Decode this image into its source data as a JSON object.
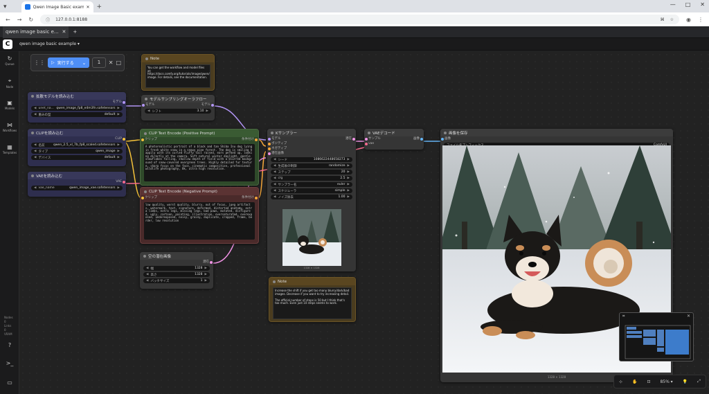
{
  "browser": {
    "tab_title": "Qwen Image Basic example",
    "new_tab": "+",
    "url": "127.0.0.1:8188",
    "window_controls": [
      "—",
      "□",
      "✕"
    ]
  },
  "workflow": {
    "tab_label": "qwen image basic e...",
    "tab_close": "✕",
    "add_tab": "+",
    "menu_title": "qwen image basic example ▾"
  },
  "sidebar": [
    {
      "label": "Queue",
      "icon": "history-icon",
      "glyph": "↻"
    },
    {
      "label": "Node",
      "icon": "node-library-icon",
      "glyph": "⌖"
    },
    {
      "label": "Models",
      "icon": "models-icon",
      "glyph": "▣"
    },
    {
      "label": "Workflows",
      "icon": "workflows-icon",
      "glyph": "⋈"
    },
    {
      "label": "Templates",
      "icon": "templates-icon",
      "glyph": "▦"
    }
  ],
  "sidebar_bottom": [
    {
      "icon": "help-icon",
      "glyph": "?"
    },
    {
      "icon": "terminal-icon",
      "glyph": ">_"
    },
    {
      "icon": "console-icon",
      "glyph": "▭"
    }
  ],
  "run": {
    "label": "実行する",
    "count": "1",
    "cancel": "✕",
    "stop": "□"
  },
  "nodes": {
    "note1": {
      "title": "Note",
      "text": "You can get the workflow and model files at: https://docs.comfy.org/tutorials/image/qwen/qwen-image. For details, see the documentation."
    },
    "sampling": {
      "title": "モデルサンプリングオーラフロー",
      "in_model": "モデル",
      "out_model": "モデル",
      "w_shift": {
        "name": "シフト",
        "value": "3.10"
      }
    },
    "unet": {
      "title": "拡散モデルを読み込む",
      "out": "モデル",
      "w_name": {
        "name": "unet_na...",
        "value": "qwen_image_fp8_e4m3fn.safetensors"
      },
      "w_dtype": {
        "name": "重みの型",
        "value": "default"
      }
    },
    "clip": {
      "title": "CLIPを読み込む",
      "out": "CLIP",
      "w_name": {
        "name": "名前",
        "value": "qwen_2.5_vl_7b_fp8_scaled.safetensors"
      },
      "w_type": {
        "name": "タイプ",
        "value": "qwen_image"
      },
      "w_device": {
        "name": "デバイス",
        "value": "default"
      }
    },
    "vae": {
      "title": "VAEを読み込む",
      "out": "VAE",
      "w_name": {
        "name": "vae_name",
        "value": "qwen_image_vae.safetensors"
      }
    },
    "pos": {
      "title": "CLIP Text Encode (Positive Prompt)",
      "in_clip": "クリップ",
      "out_cond": "条件付け",
      "text": "A photorealistic portrait of a black and tan Shiba Inu dog lying in fresh white snow in a snowy pine forest. The dog is smiling happily with its curled fluffy tail raised, ears perked up, looking directly at the camera. Soft natural winter daylight, gentle snowflakes falling, shallow depth of field with a blurred background of snow-covered evergreen trees. Highly detailed fur texture, sharp focus on the face, cinematic composition, professional wildlife photography, 8k, ultra high resolution."
    },
    "neg": {
      "title": "CLIP Text Encode (Negative Prompt)",
      "in_clip": "クリップ",
      "out_cond": "条件付け",
      "text": "low quality, worst quality, blurry, out of focus, jpeg artifacts, watermark, text, signature, deformed, distorted anatomy, extra limbs, extra legs, missing legs, bad paws, mutated, disfigured, ugly, cartoon, painting, illustration, oversaturated, overexposed, underexposed, noisy, grainy, duplicate, cropped, frame, border, low resolution"
    },
    "latent": {
      "title": "空の潜在画像",
      "out": "潜在",
      "w_width": {
        "name": "幅",
        "value": "1328"
      },
      "w_height": {
        "name": "高さ",
        "value": "1328"
      },
      "w_batch": {
        "name": "バッチサイズ",
        "value": "1"
      }
    },
    "ksampler": {
      "title": "Kサンプラー",
      "in_model": "モデル",
      "in_pos": "ポジティブ",
      "in_neg": "ネガティブ",
      "in_latent": "潜在画像",
      "out": "潜在",
      "widgets": [
        {
          "name": "シード",
          "value": "1086622448658273"
        },
        {
          "name": "生成後の制御",
          "value": "randomize"
        },
        {
          "name": "ステップ",
          "value": "20"
        },
        {
          "name": "cfg",
          "value": "2.5"
        },
        {
          "name": "サンプラー名",
          "value": "euler"
        },
        {
          "name": "スケジューラ",
          "value": "simple"
        },
        {
          "name": "ノイズ除去",
          "value": "1.00"
        }
      ],
      "preview_caption": "1328 × 1328"
    },
    "decode": {
      "title": "VAEデコード",
      "in_samples": "サンプル",
      "in_vae": "vae",
      "out": "画像"
    },
    "save": {
      "title": "画像を保存",
      "in_images": "画像",
      "w_prefix": {
        "name": "ファイル名プレフィックス",
        "value": "ComfyUI"
      },
      "caption": "1328 × 1328"
    },
    "note2": {
      "title": "Note",
      "text": "Increase the shift if you get too many blurry/dark/bad images. Decrease if you want to try increasing detail.\n\nThe official number of steps is 50 but I think that's too much. Even just 10 steps seems to work."
    }
  },
  "minimap": {
    "icon": "map-icon",
    "close": "✕"
  },
  "zoombar": {
    "zoom": "85% ▾",
    "items": [
      "⊹",
      "✋",
      "⊡",
      "💡",
      "⤢"
    ]
  },
  "bottom_left": [
    "Nodes",
    "0",
    "Links",
    "0",
    "VRAM"
  ],
  "colors": {
    "clip": "#f5c23a",
    "model": "#b295f5",
    "vae": "#f56b8f",
    "conditioning": "#f5a63a",
    "latent": "#f092e4",
    "image": "#64b5f6",
    "run_button": "#4f8ff7"
  }
}
